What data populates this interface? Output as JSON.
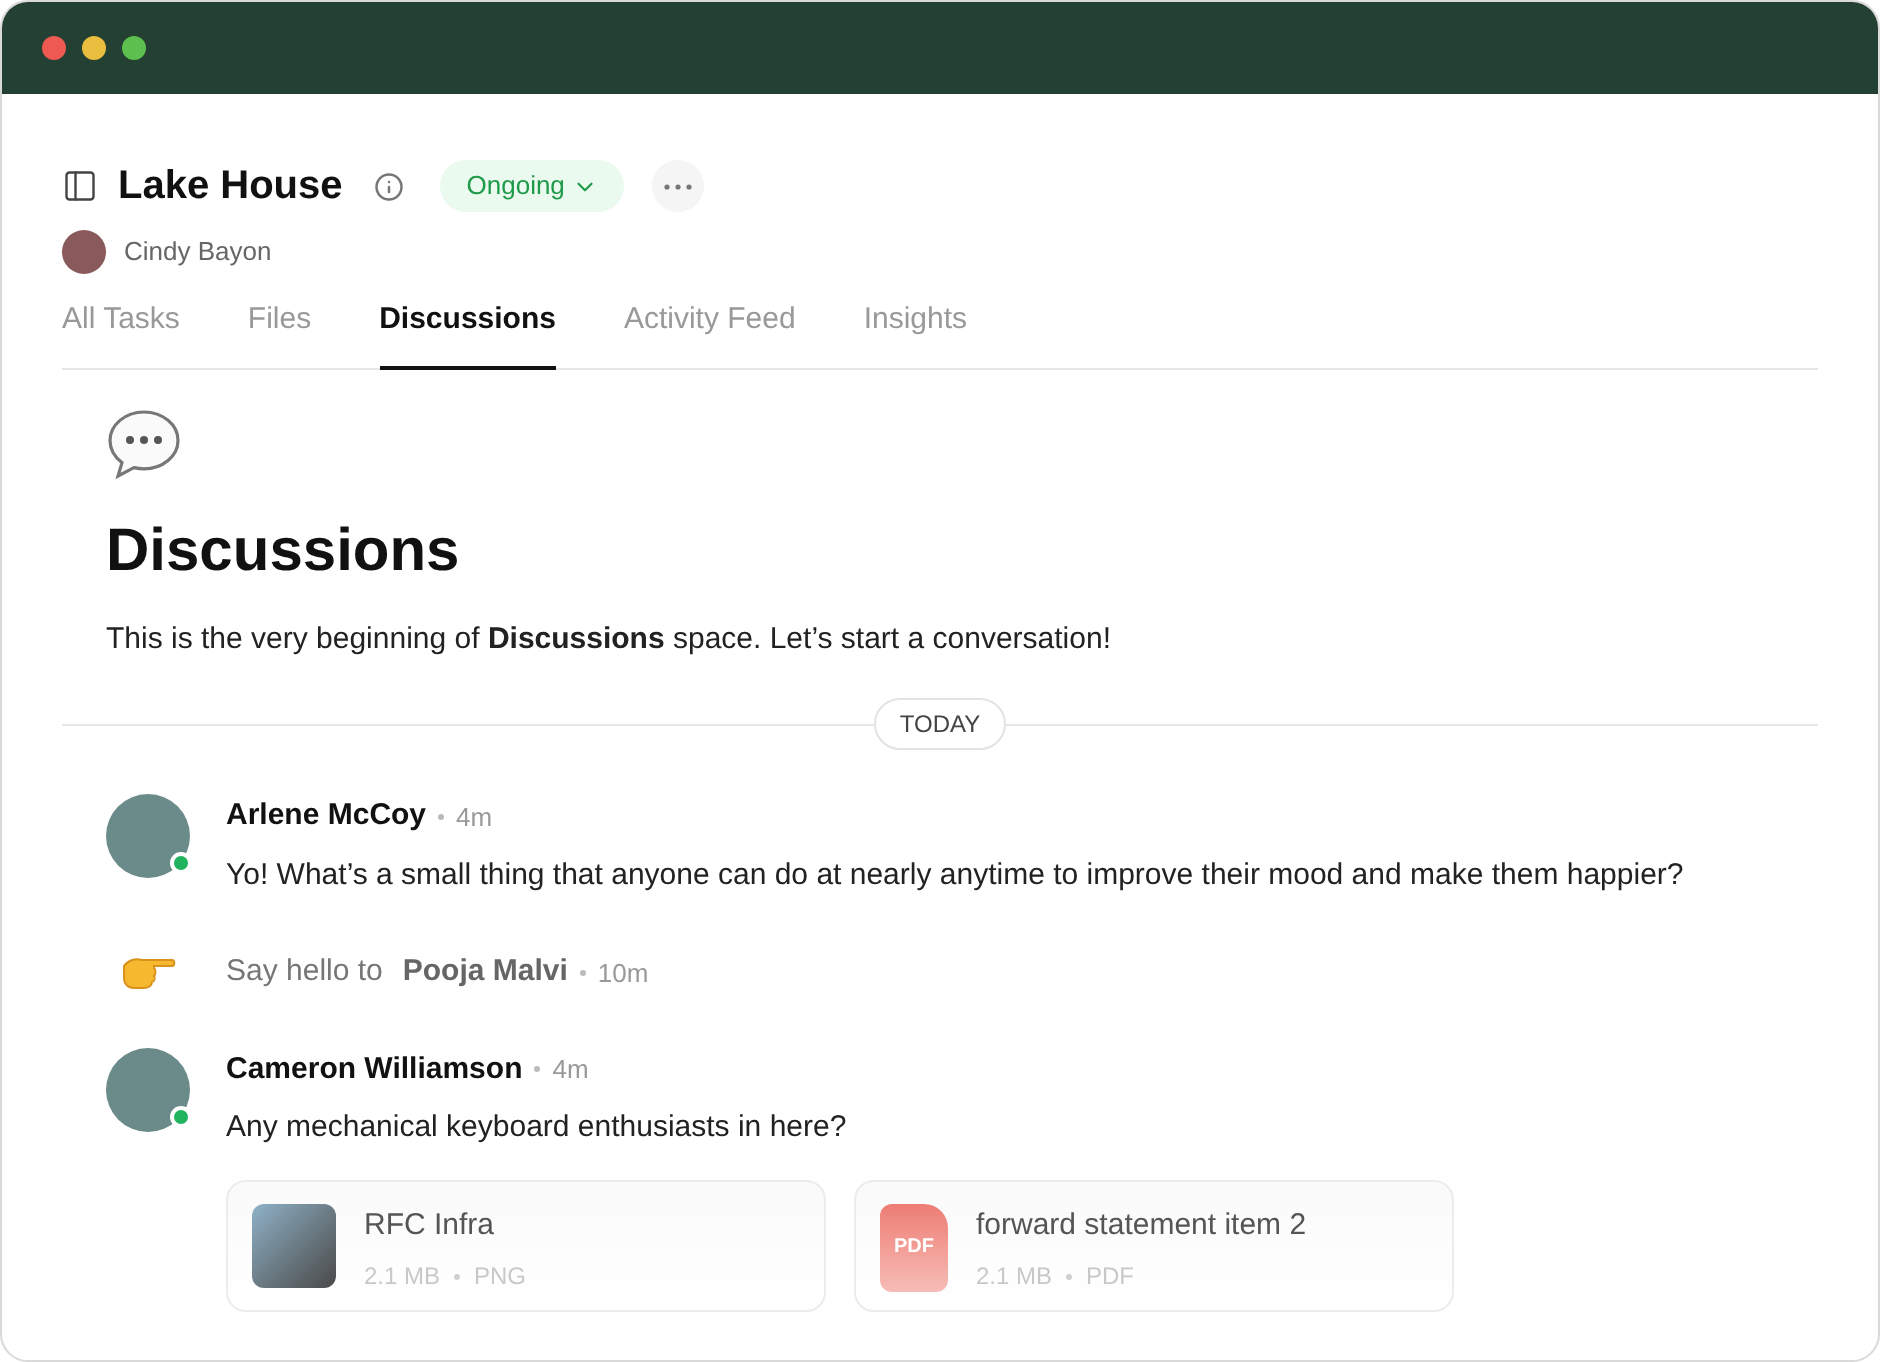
{
  "project": {
    "title": "Lake House",
    "status": "Ongoing",
    "owner": "Cindy Bayon"
  },
  "tabs": [
    {
      "label": "All Tasks",
      "selected": false
    },
    {
      "label": "Files",
      "selected": false
    },
    {
      "label": "Discussions",
      "selected": true
    },
    {
      "label": "Activity Feed",
      "selected": false
    },
    {
      "label": "Insights",
      "selected": false
    }
  ],
  "intro": {
    "title": "Discussions",
    "text": "This is the very beginning of **Discussions** space. Let’s start a conversation!"
  },
  "divider_label": "TODAY",
  "messages": [
    {
      "kind": "message",
      "author": "Arlene McCoy",
      "time": "4m",
      "online": true,
      "text": "Yo! What’s a small thing that anyone can do at nearly anytime to improve their mood and make them happier?"
    },
    {
      "kind": "event",
      "prefix": "Say hello to",
      "author": "Pooja Malvi",
      "time": "10m"
    },
    {
      "kind": "message",
      "author": "Cameron Williamson",
      "time": "4m",
      "online": true,
      "text": "Any mechanical keyboard enthusiasts in here?",
      "attachments": [
        {
          "kind": "image",
          "name": "RFC Infra",
          "size": "2.1 MB",
          "type": "PNG"
        },
        {
          "kind": "pdf",
          "name": "forward statement item 2",
          "size": "2.1 MB",
          "type": "PDF",
          "icon_label": "PDF"
        }
      ]
    }
  ]
}
